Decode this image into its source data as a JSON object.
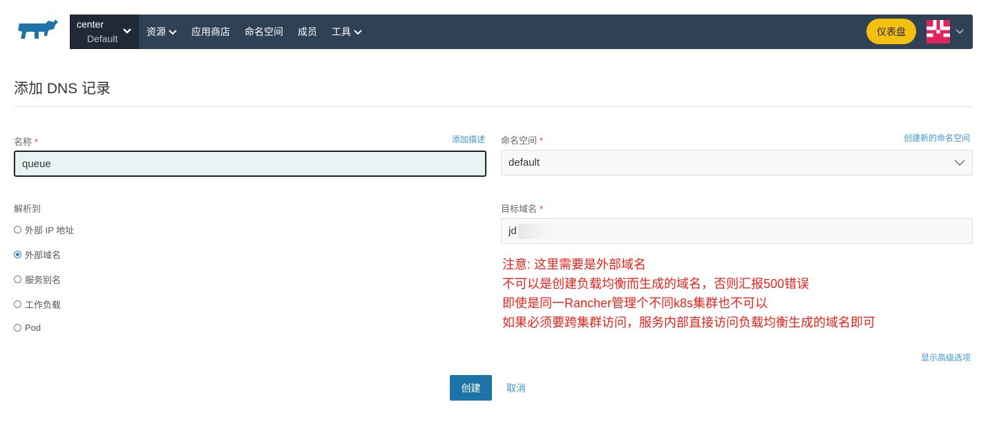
{
  "header": {
    "cluster_name": "center",
    "project_name": "Default",
    "nav": [
      {
        "label": "资源",
        "dropdown": true
      },
      {
        "label": "应用商店",
        "dropdown": false
      },
      {
        "label": "命名空间",
        "dropdown": false
      },
      {
        "label": "成员",
        "dropdown": false
      },
      {
        "label": "工具",
        "dropdown": true
      }
    ],
    "dashboard_button": "仪表盘",
    "colors": {
      "bar": "#2f4155",
      "cluster_bg": "#1f2a36",
      "dashboard": "#f3c010"
    }
  },
  "page": {
    "title": "添加 DNS 记录"
  },
  "form": {
    "name_label": "名称",
    "add_description_link": "添加描述",
    "name_value": "queue",
    "namespace_label": "命名空间",
    "create_namespace_link": "创建新的命名空间",
    "namespace_value": "default",
    "resolve_label": "解析到",
    "resolve_options": [
      {
        "label": "外部 IP 地址",
        "checked": false
      },
      {
        "label": "外部域名",
        "checked": true
      },
      {
        "label": "服务别名",
        "checked": false
      },
      {
        "label": "工作负载",
        "checked": false
      },
      {
        "label": "Pod",
        "checked": false
      }
    ],
    "target_label": "目标域名",
    "target_value": "jd",
    "required_mark": "*",
    "advanced_link": "显示高级选项"
  },
  "annotation": {
    "lines": [
      "注意: 这里需要是外部域名",
      "不可以是创建负载均衡而生成的域名，否则汇报500错误",
      "即使是同一Rancher管理个不同k8s集群也不可以",
      "如果必须要跨集群访问，服务内部直接访问负载均衡生成的域名即可"
    ],
    "color": "#e8231b"
  },
  "actions": {
    "create": "创建",
    "cancel": "取消"
  }
}
